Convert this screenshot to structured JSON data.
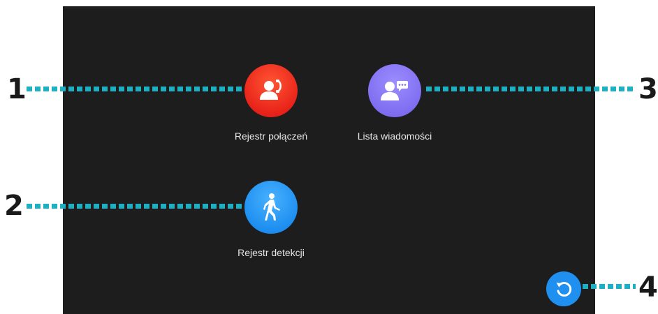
{
  "apps": [
    {
      "id": "call-log",
      "label": "Rejestr połączeń",
      "icon": "person-phone-icon",
      "color": "#e8231a"
    },
    {
      "id": "message-list",
      "label": "Lista wiadomości",
      "icon": "person-message-icon",
      "color": "#7f6ef0"
    },
    {
      "id": "detection-log",
      "label": "Rejestr detekcji",
      "icon": "walking-person-icon",
      "color": "#1e8ff0"
    }
  ],
  "refresh_button": {
    "icon": "refresh-icon",
    "color": "#1f8ff0"
  },
  "callouts": [
    {
      "number": "1"
    },
    {
      "number": "2"
    },
    {
      "number": "3"
    },
    {
      "number": "4"
    }
  ],
  "callout_color": "#1dafc4"
}
